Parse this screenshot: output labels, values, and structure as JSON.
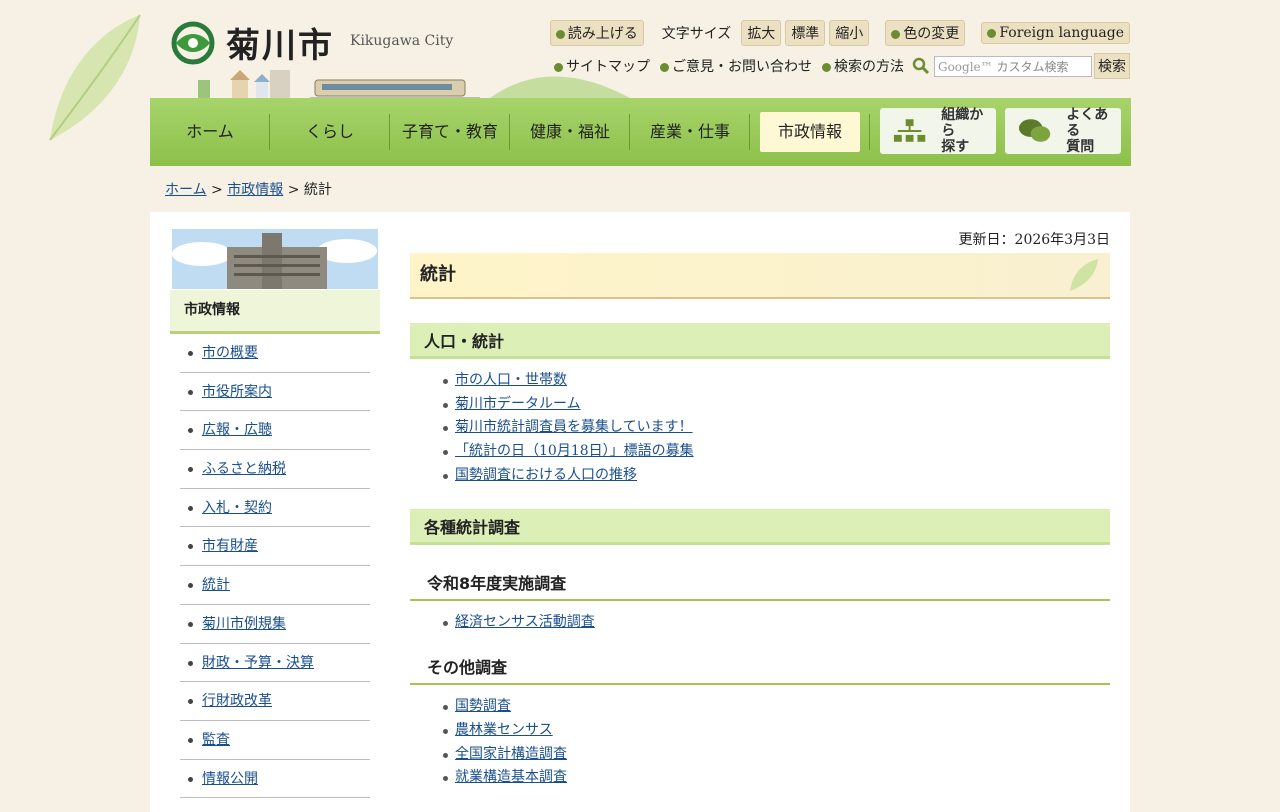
{
  "header": {
    "logo_text": "菊川市",
    "logo_sub": "Kikugawa City",
    "tools": {
      "read_aloud": "読み上げる",
      "font_size_label": "文字サイズ",
      "font_large": "拡大",
      "font_standard": "標準",
      "font_small": "縮小",
      "color_change": "色の変更",
      "foreign_language": "Foreign language",
      "sitemap": "サイトマップ",
      "opinion": "ご意見・お問い合わせ",
      "search_method": "検索の方法",
      "search_placeholder": "カスタム検索",
      "search_button": "検索"
    }
  },
  "nav": {
    "items": [
      "ホーム",
      "くらし",
      "子育て・教育",
      "健康・福祉",
      "産業・仕事",
      "市政情報"
    ],
    "org_search_line1": "組織から",
    "org_search_line2": "探す",
    "faq_line1": "よくある",
    "faq_line2": "質問"
  },
  "breadcrumb": {
    "home": "ホーム",
    "sep1": ">",
    "city_info": "市政情報",
    "sep2": ">",
    "current": "統計"
  },
  "sidebar": {
    "heading": "市政情報",
    "items": [
      "市の概要",
      "市役所案内",
      "広報・広聴",
      "ふるさと納税",
      "入札・契約",
      "市有財産",
      "統計",
      "菊川市例規集",
      "財政・予算・決算",
      "行財政改革",
      "監査",
      "情報公開"
    ]
  },
  "main": {
    "updated": "更新日：2026年3月3日",
    "title": "統計",
    "section1": {
      "heading": "人口・統計",
      "links": [
        "市の人口・世帯数",
        "菊川市データルーム",
        "菊川市統計調査員を募集しています！",
        "「統計の日（10月18日）」標語の募集",
        "国勢調査における人口の推移"
      ]
    },
    "section2": {
      "heading": "各種統計調査",
      "sub1": {
        "heading": "令和8年度実施調査",
        "links": [
          "経済センサス活動調査"
        ]
      },
      "sub2": {
        "heading": "その他調査",
        "links": [
          "国勢調査",
          "農林業センサス",
          "全国家計構造調査",
          "就業構造基本調査"
        ]
      }
    }
  },
  "colors": {
    "nav_green": "#8cc04a",
    "section_green": "#dbefb7",
    "link_blue": "#1a4f8f",
    "page_bg": "#f6f1e4"
  }
}
